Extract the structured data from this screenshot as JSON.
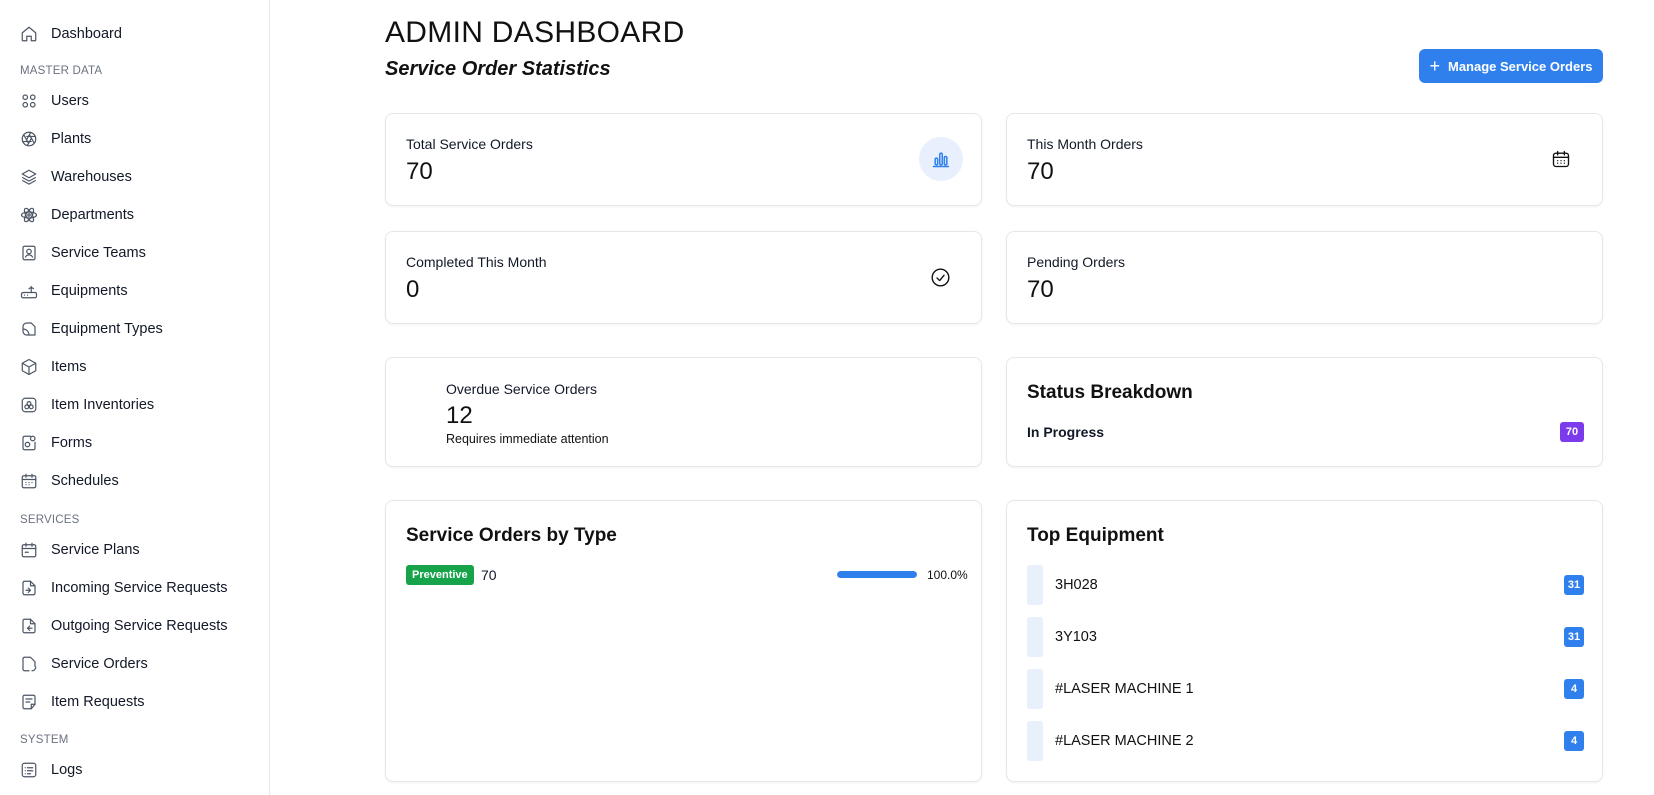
{
  "sidebar": {
    "items": [
      {
        "label": "Dashboard",
        "icon": "home-icon"
      },
      {
        "label": "Users",
        "icon": "users-icon"
      },
      {
        "label": "Plants",
        "icon": "aperture-icon"
      },
      {
        "label": "Warehouses",
        "icon": "layers-icon"
      },
      {
        "label": "Departments",
        "icon": "atom-icon"
      },
      {
        "label": "Service Teams",
        "icon": "contact-icon"
      },
      {
        "label": "Equipments",
        "icon": "router-icon"
      },
      {
        "label": "Equipment Types",
        "icon": "shapes-icon"
      },
      {
        "label": "Items",
        "icon": "box-icon"
      },
      {
        "label": "Item Inventories",
        "icon": "inventory-icon"
      },
      {
        "label": "Forms",
        "icon": "form-icon"
      },
      {
        "label": "Schedules",
        "icon": "calendar-icon"
      },
      {
        "label": "Service Plans",
        "icon": "calendar-plan-icon"
      },
      {
        "label": "Incoming Service Requests",
        "icon": "incoming-icon"
      },
      {
        "label": "Outgoing Service Requests",
        "icon": "outgoing-icon"
      },
      {
        "label": "Service Orders",
        "icon": "order-icon"
      },
      {
        "label": "Item Requests",
        "icon": "request-icon"
      },
      {
        "label": "Logs",
        "icon": "logs-icon"
      }
    ],
    "sections": {
      "master_data": "MASTER DATA",
      "services": "SERVICES",
      "system": "SYSTEM"
    }
  },
  "header": {
    "title": "ADMIN DASHBOARD",
    "subtitle": "Service Order Statistics",
    "manage_button": "Manage Service Orders"
  },
  "stats": {
    "total": {
      "label": "Total Service Orders",
      "value": "70",
      "icon": "bar-chart-icon"
    },
    "this_month": {
      "label": "This Month Orders",
      "value": "70",
      "icon": "calendar-icon"
    },
    "completed": {
      "label": "Completed This Month",
      "value": "0",
      "icon": "check-circle-icon"
    },
    "pending": {
      "label": "Pending Orders",
      "value": "70"
    },
    "overdue": {
      "label": "Overdue Service Orders",
      "value": "12",
      "note": "Requires immediate attention"
    }
  },
  "status_breakdown": {
    "title": "Status Breakdown",
    "items": [
      {
        "label": "In Progress",
        "count": "70"
      }
    ]
  },
  "by_type": {
    "title": "Service Orders by Type",
    "items": [
      {
        "type": "Preventive",
        "count": "70",
        "percent_label": "100.0%",
        "percent": 100
      }
    ]
  },
  "top_equipment": {
    "title": "Top Equipment",
    "items": [
      {
        "name": "3H028",
        "count": "31"
      },
      {
        "name": "3Y103",
        "count": "31"
      },
      {
        "name": "#LASER MACHINE 1",
        "count": "4"
      },
      {
        "name": "#LASER MACHINE 2",
        "count": "4"
      }
    ]
  },
  "colors": {
    "primary": "#2f80ed",
    "success": "#16a34a",
    "purple": "#7c3aed"
  }
}
